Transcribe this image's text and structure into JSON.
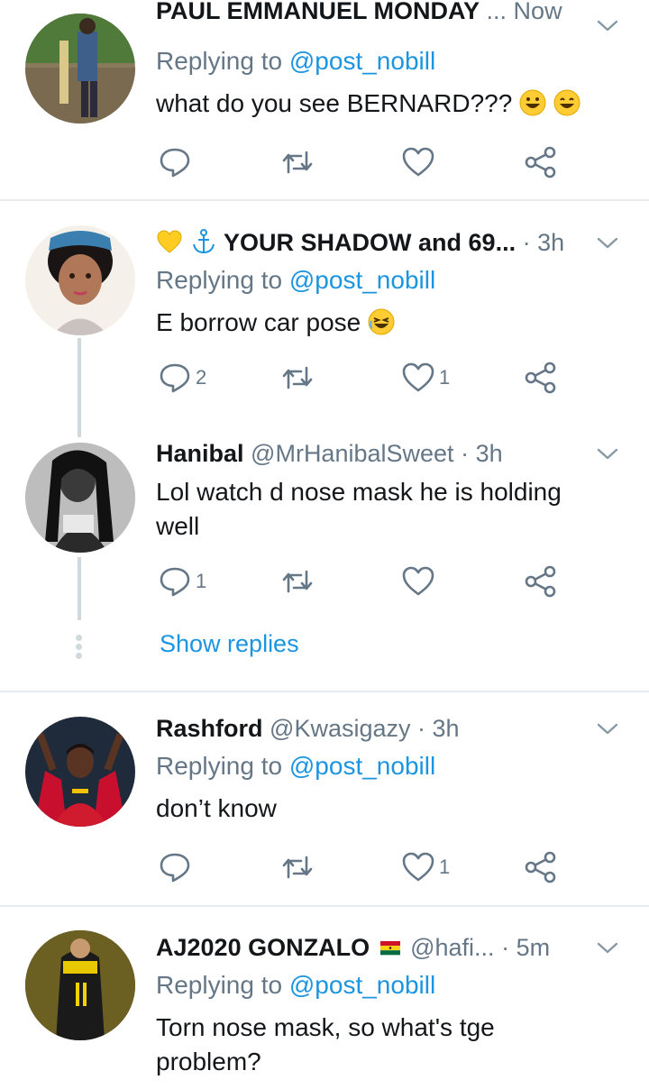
{
  "tweets": [
    {
      "name": "PAUL EMMANUEL MONDAY",
      "time": "... Now",
      "replying_prefix": "Replying to",
      "replying_to": "@post_nobill",
      "text": "what do you see BERNARD???",
      "replies": "",
      "likes": ""
    },
    {
      "name": "YOUR SHADOW and 69...",
      "dot": "·",
      "time": "3h",
      "replying_prefix": "Replying to",
      "replying_to": "@post_nobill",
      "text": "E borrow car pose",
      "replies": "2",
      "likes": "1"
    },
    {
      "name": "Hanibal",
      "handle": "@MrHanibalSweet",
      "dot": "·",
      "time": "3h",
      "text": "Lol watch d nose mask he is holding well",
      "replies": "1",
      "likes": "",
      "show_replies": "Show replies"
    },
    {
      "name": "Rashford",
      "handle": "@Kwasigazy",
      "dot": "·",
      "time": "3h",
      "replying_prefix": "Replying to",
      "replying_to": "@post_nobill",
      "text": "don’t know",
      "replies": "",
      "likes": "1"
    },
    {
      "name": "AJ2020 GONZALO",
      "handle": "@hafi...",
      "dot": "·",
      "time": "5m",
      "replying_prefix": "Replying to",
      "replying_to": "@post_nobill",
      "text": "Torn nose mask, so what's tge problem?"
    }
  ],
  "icons": [
    "reply-icon",
    "retweet-icon",
    "like-icon",
    "share-icon",
    "chevron-down-icon"
  ],
  "colors": {
    "link": "#1b95e0",
    "muted": "#657786",
    "divider": "#e6ecf0"
  }
}
